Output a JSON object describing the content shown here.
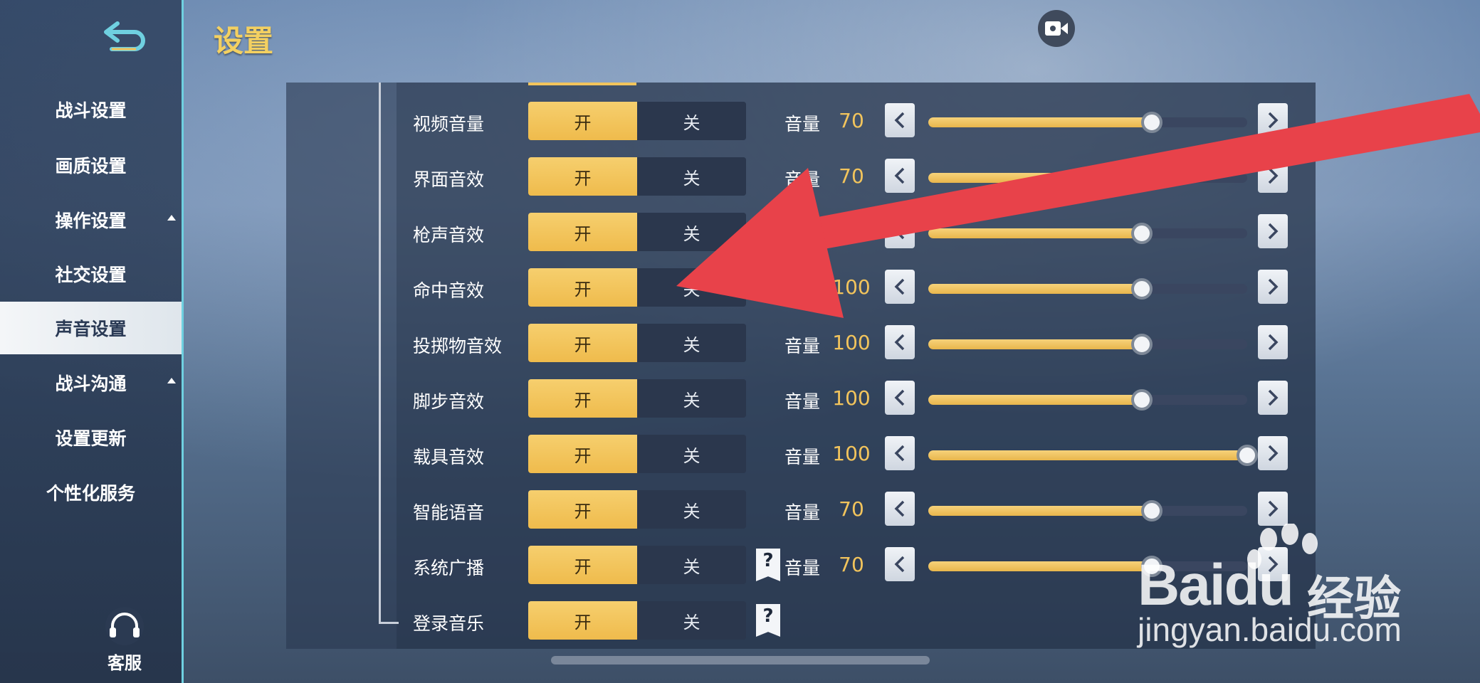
{
  "header": {
    "title": "设置"
  },
  "sidebar": {
    "items": [
      {
        "label": "战斗设置",
        "expandable": false,
        "active": false
      },
      {
        "label": "画质设置",
        "expandable": false,
        "active": false
      },
      {
        "label": "操作设置",
        "expandable": true,
        "active": false
      },
      {
        "label": "社交设置",
        "expandable": false,
        "active": false
      },
      {
        "label": "声音设置",
        "expandable": false,
        "active": true
      },
      {
        "label": "战斗沟通",
        "expandable": true,
        "active": false
      },
      {
        "label": "设置更新",
        "expandable": false,
        "active": false
      },
      {
        "label": "个性化服务",
        "expandable": false,
        "active": false
      }
    ],
    "support_label": "客服"
  },
  "sound": {
    "toggle_on": "开",
    "toggle_off": "关",
    "volume_label": "音量",
    "rows": [
      {
        "label": "视频音量",
        "on": true,
        "volume": "70",
        "level": 0.7,
        "help": false
      },
      {
        "label": "界面音效",
        "on": true,
        "volume": "70",
        "level": 0.7,
        "help": false
      },
      {
        "label": "枪声音效",
        "on": true,
        "volume": "",
        "level": 0.67,
        "help": false
      },
      {
        "label": "命中音效",
        "on": true,
        "volume": "100",
        "level": 0.67,
        "help": false
      },
      {
        "label": "投掷物音效",
        "on": true,
        "volume": "100",
        "level": 0.67,
        "help": false
      },
      {
        "label": "脚步音效",
        "on": true,
        "volume": "100",
        "level": 0.67,
        "help": false
      },
      {
        "label": "载具音效",
        "on": true,
        "volume": "100",
        "level": 1.0,
        "help": false
      },
      {
        "label": "智能语音",
        "on": true,
        "volume": "70",
        "level": 0.7,
        "help": false
      },
      {
        "label": "系统广播",
        "on": true,
        "volume": "70",
        "level": 0.7,
        "help": true
      },
      {
        "label": "登录音乐",
        "on": true,
        "volume": null,
        "level": null,
        "help": true
      }
    ]
  },
  "watermark": {
    "brand": "Baidu",
    "cn": "经验",
    "url": "jingyan.baidu.com"
  },
  "colors": {
    "accent": "#f2c45c",
    "annotation_arrow": "#e8424a",
    "sidebar_border": "#6fd0e0"
  }
}
